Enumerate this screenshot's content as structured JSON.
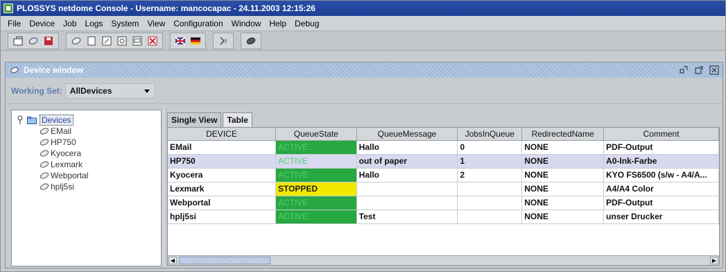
{
  "window": {
    "title": "PLOSSYS netdome Console - Username: mancocapac - 24.11.2003 12:15:26"
  },
  "menu": [
    "File",
    "Device",
    "Job",
    "Logs",
    "System",
    "View",
    "Configuration",
    "Window",
    "Help",
    "Debug"
  ],
  "toolbar": {
    "icons": [
      "new-icon",
      "open-icon",
      "save-icon",
      "device-icon",
      "document-icon",
      "edit-icon",
      "settings-icon",
      "window-icon",
      "close-icon",
      "uk-flag-icon",
      "german-flag-icon",
      "help-icon",
      "monitor-icon"
    ]
  },
  "device_window": {
    "title": "Device window"
  },
  "working_set": {
    "label": "Working Set:",
    "value": "AllDevices"
  },
  "tree": {
    "root": "Devices",
    "children": [
      "EMail",
      "HP750",
      "Kyocera",
      "Lexmark",
      "Webportal",
      "hplj5si"
    ]
  },
  "tabs": [
    "Single View",
    "Table"
  ],
  "table": {
    "columns": [
      "DEVICE",
      "QueueState",
      "QueueMessage",
      "JobsInQueue",
      "RedirectedName",
      "Comment"
    ],
    "rows": [
      {
        "device": "EMail",
        "state": "ACTIVE",
        "message": "Hallo",
        "jobs": "0",
        "redirected": "NONE",
        "comment": "PDF-Output"
      },
      {
        "device": "HP750",
        "state": "ACTIVE",
        "message": "out of paper",
        "jobs": "1",
        "redirected": "NONE",
        "comment": "A0-Ink-Farbe"
      },
      {
        "device": "Kyocera",
        "state": "ACTIVE",
        "message": "Hallo",
        "jobs": "2",
        "redirected": "NONE",
        "comment": "KYO FS6500 (s/w - A4/A..."
      },
      {
        "device": "Lexmark",
        "state": "STOPPED",
        "message": "",
        "jobs": "",
        "redirected": "NONE",
        "comment": "A4/A4 Color"
      },
      {
        "device": "Webportal",
        "state": "ACTIVE",
        "message": "",
        "jobs": "",
        "redirected": "NONE",
        "comment": "PDF-Output"
      },
      {
        "device": "hplj5si",
        "state": "ACTIVE",
        "message": "Test",
        "jobs": "",
        "redirected": "NONE",
        "comment": "unser Drucker"
      }
    ],
    "selected_row": 1
  },
  "colors": {
    "active": "#27a841",
    "stopped": "#f2e800",
    "title": "#1e3f94"
  }
}
